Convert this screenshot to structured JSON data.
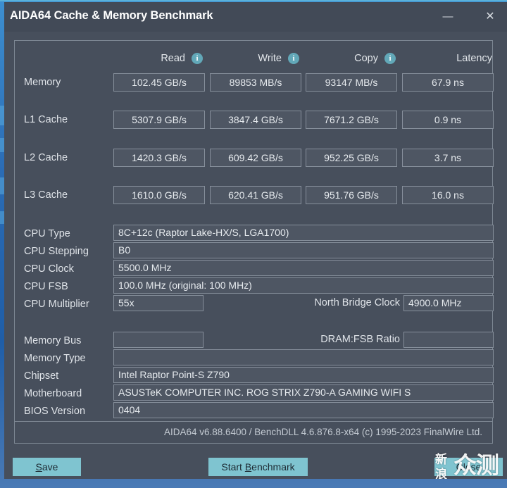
{
  "window": {
    "title": "AIDA64 Cache & Memory Benchmark",
    "minimize_label": "—",
    "close_label": "✕"
  },
  "bench": {
    "columns": [
      {
        "label": "Read",
        "info": "info-icon"
      },
      {
        "label": "Write",
        "info": "info-icon"
      },
      {
        "label": "Copy",
        "info": "info-icon"
      },
      {
        "label": "Latency",
        "info": ""
      }
    ],
    "rows": [
      {
        "label": "Memory",
        "read": "102.45 GB/s",
        "write": "89853 MB/s",
        "copy": "93147 MB/s",
        "latency": "67.9 ns"
      },
      {
        "label": "L1 Cache",
        "read": "5307.9 GB/s",
        "write": "3847.4 GB/s",
        "copy": "7671.2 GB/s",
        "latency": "0.9 ns"
      },
      {
        "label": "L2 Cache",
        "read": "1420.3 GB/s",
        "write": "609.42 GB/s",
        "copy": "952.25 GB/s",
        "latency": "3.7 ns"
      },
      {
        "label": "L3 Cache",
        "read": "1610.0 GB/s",
        "write": "620.41 GB/s",
        "copy": "951.76 GB/s",
        "latency": "16.0 ns"
      }
    ]
  },
  "system": {
    "cpu_type_label": "CPU Type",
    "cpu_type_value": "8C+12c   (Raptor Lake-HX/S, LGA1700)",
    "cpu_stepping_label": "CPU Stepping",
    "cpu_stepping_value": "B0",
    "cpu_clock_label": "CPU Clock",
    "cpu_clock_value": "5500.0 MHz",
    "cpu_fsb_label": "CPU FSB",
    "cpu_fsb_value": "100.0 MHz  (original: 100 MHz)",
    "cpu_multiplier_label": "CPU Multiplier",
    "cpu_multiplier_value": "55x",
    "north_bridge_label": "North Bridge Clock",
    "north_bridge_value": "4900.0 MHz",
    "memory_bus_label": "Memory Bus",
    "memory_bus_value": "",
    "dram_fsb_label": "DRAM:FSB Ratio",
    "dram_fsb_value": "",
    "memory_type_label": "Memory Type",
    "memory_type_value": "",
    "chipset_label": "Chipset",
    "chipset_value": "Intel Raptor Point-S Z790",
    "motherboard_label": "Motherboard",
    "motherboard_value": "ASUSTeK COMPUTER INC. ROG STRIX Z790-A GAMING WIFI S",
    "bios_label": "BIOS Version",
    "bios_value": "0404"
  },
  "footer": {
    "version_text": "AIDA64 v6.88.6400 / BenchDLL 4.6.876.8-x64  (c) 1995-2023 FinalWire Ltd.",
    "save_label": "Save",
    "save_accel": "S",
    "start_label_pre": "Start ",
    "start_accel": "B",
    "start_label_post": "enchmark",
    "close_label": "Close"
  },
  "watermark": {
    "big": "众测",
    "small_top": "新",
    "small_bottom": "浪"
  },
  "colors": {
    "window_bg": "#474f5c",
    "titlebar_bg": "#424a57",
    "field_bg": "#4e5663",
    "field_border": "#868f9b",
    "accent_button": "#7fc4d0",
    "info_icon": "#62a8b8",
    "desktop": "#2f6fb5"
  }
}
